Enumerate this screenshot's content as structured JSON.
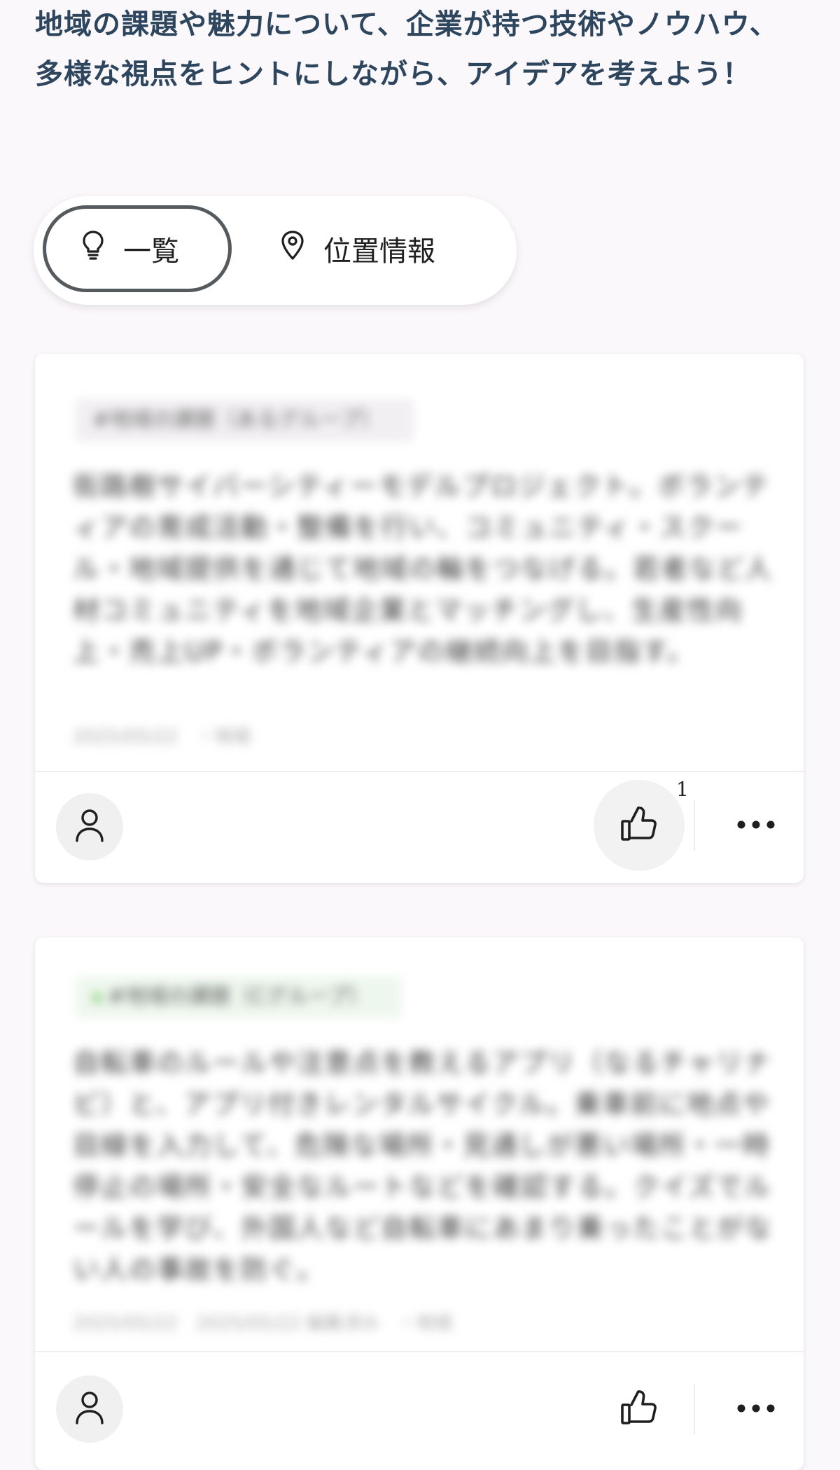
{
  "intro": "地域の課題や魅力について、企業が持つ技術やノウハウ、多様な視点をヒントにしながら、アイデアを考えよう！",
  "view_toggle": {
    "list_label": "一覧",
    "map_label": "位置情報",
    "active": "list"
  },
  "cards": [
    {
      "tag": "#地域の課題（あるグループ）",
      "body": "街路樹サイバーシティーモデルプロジェクト。ボランティアの育成活動・整備を行い、コミュニティ・スクール・地域提供を通じて地域の輪をつなげる。若者など人材コミュニティを地域企業とマッチングし、生産性向上・売上UP・ボランティアの継続向上を目指す。",
      "meta": "2025/05/22　・地域",
      "likes": "1",
      "icons": [
        "person-icon",
        "thumbs-up-icon",
        "more-horizontal-icon"
      ]
    },
    {
      "tag": "#地域の課題（Cグループ）",
      "body": "自転車のルールや注意点を教えるアプリ（なるチャリナビ）と、アプリ付きレンタルサイクル。乗車前に地点や目線を入力して、危険な場所・見通しが悪い場所・一時停止の場所・安全なルートなどを確認する。クイズでルールを学び、外国人など自転車にあまり乗ったことがない人の事故を防ぐ。",
      "meta": "2025/05/22　2025/05/22 編集済み　・地域",
      "likes": "",
      "icons": [
        "person-icon",
        "thumbs-up-icon",
        "more-horizontal-icon"
      ]
    }
  ]
}
